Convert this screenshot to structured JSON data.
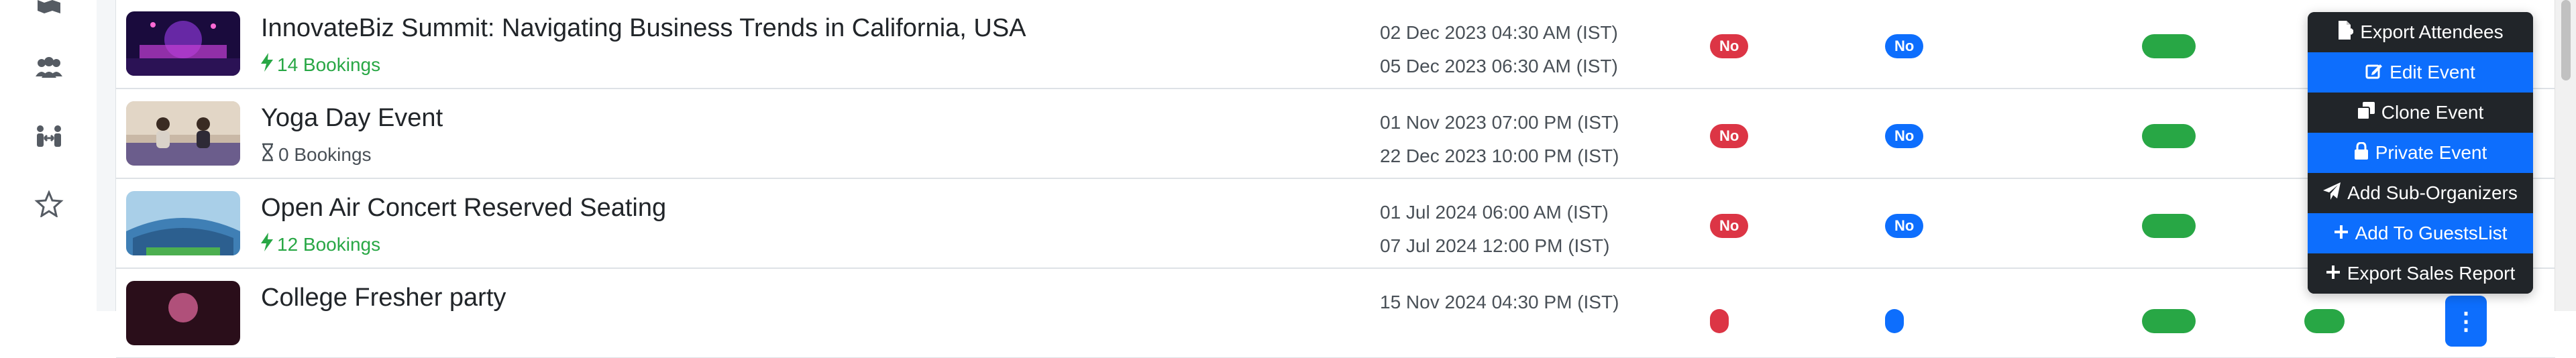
{
  "sidebar": {
    "icons": [
      "map-icon",
      "users-group-icon",
      "people-arrows-icon",
      "star-icon"
    ]
  },
  "events": [
    {
      "title": "InnovateBiz Summit: Navigating Business Trends in California, USA",
      "bookings": "14 Bookings",
      "bookings_state": "active",
      "start": "02 Dec 2023 04:30 AM (IST)",
      "end": "05 Dec 2023 06:30 AM (IST)",
      "badge_1": "No",
      "badge_2": "No"
    },
    {
      "title": "Yoga Day Event",
      "bookings": "0 Bookings",
      "bookings_state": "none",
      "start": "01 Nov 2023 07:00 PM (IST)",
      "end": "22 Dec 2023 10:00 PM (IST)",
      "badge_1": "No",
      "badge_2": "No"
    },
    {
      "title": "Open Air Concert Reserved Seating",
      "bookings": "12 Bookings",
      "bookings_state": "active",
      "start": "01 Jul 2024 06:00 AM (IST)",
      "end": "07 Jul 2024 12:00 PM (IST)",
      "badge_1": "No",
      "badge_2": "No"
    },
    {
      "title": "College Fresher party",
      "start": "15 Nov 2024 04:30 PM (IST)"
    }
  ],
  "dropdown": {
    "items": [
      {
        "label": "Export Attendees",
        "icon": "file-export-icon",
        "style": "dark"
      },
      {
        "label": "Edit Event",
        "icon": "edit-icon",
        "style": "blue"
      },
      {
        "label": "Clone Event",
        "icon": "clone-icon",
        "style": "dark"
      },
      {
        "label": "Private Event",
        "icon": "lock-icon",
        "style": "blue"
      },
      {
        "label": "Add Sub-Organizers",
        "icon": "paper-plane-icon",
        "style": "dark"
      },
      {
        "label": "Add To GuestsList",
        "icon": "plus-icon",
        "style": "blue"
      },
      {
        "label": "Export Sales Report",
        "icon": "plus-icon",
        "style": "dark"
      }
    ]
  },
  "colors": {
    "primary": "#0d6efd",
    "danger": "#dc3545",
    "success": "#28a745",
    "dark": "#212529"
  }
}
